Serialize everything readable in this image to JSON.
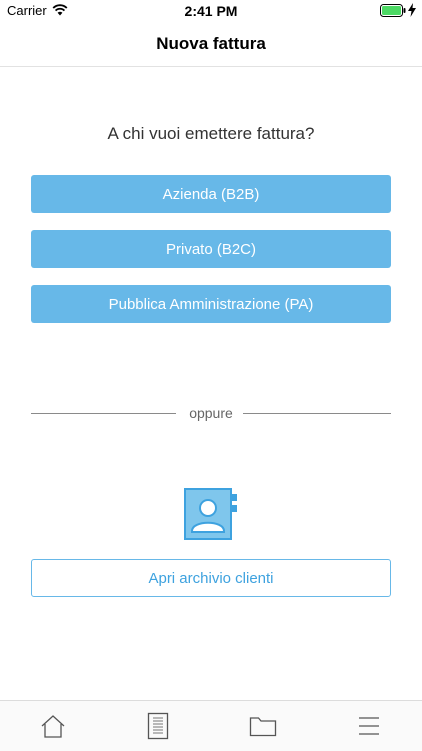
{
  "status_bar": {
    "carrier": "Carrier",
    "time": "2:41 PM"
  },
  "nav": {
    "title": "Nuova fattura"
  },
  "main": {
    "question": "A chi vuoi emettere fattura?",
    "options": [
      {
        "label": "Azienda (B2B)"
      },
      {
        "label": "Privato (B2C)"
      },
      {
        "label": "Pubblica Amministrazione (PA)"
      }
    ],
    "divider_text": "oppure",
    "archive_button": "Apri archivio clienti"
  },
  "tab_bar": {
    "icons": [
      "home-icon",
      "document-icon",
      "folder-icon",
      "menu-icon"
    ]
  },
  "colors": {
    "accent": "#67b8e8",
    "accent_text": "#3ea2df",
    "battery": "#4cd964"
  }
}
